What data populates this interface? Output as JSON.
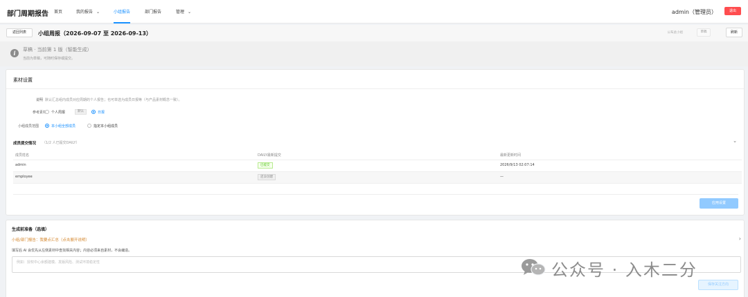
{
  "app": {
    "title": "部门周期报告"
  },
  "nav": {
    "items": [
      {
        "label": "首页",
        "has_menu": false
      },
      {
        "label": "我的报告",
        "has_menu": true
      },
      {
        "label": "小组报告",
        "has_menu": false,
        "active": true
      },
      {
        "label": "部门报告",
        "has_menu": false
      },
      {
        "label": "管理",
        "has_menu": true
      }
    ]
  },
  "user": {
    "name": "admin（管理员）",
    "logout_label": "退出"
  },
  "page": {
    "back_label": "返回列表",
    "title": "小组周报（2026-09-07 至 2026-09-13）",
    "publish_label": "公布此小组",
    "draft_label": "草稿",
    "new_label": "刷新"
  },
  "status": {
    "title": "草稿 · 当前第 1 版（智能生成）",
    "subtitle": "当前为草稿，可随时保存或提交。"
  },
  "material": {
    "title": "素材设置",
    "desc_label": "说明",
    "desc_text": "默认汇总组内成员对应周期的个人报告；也可单选为成员日报等（与产品素材概念一致）。",
    "ref_label": "参考素材",
    "ref_options": [
      "个人周报",
      "日报"
    ],
    "ref_default_tag": "默认",
    "ref_selected": "日报",
    "scope_label": "小组成员范围",
    "scope_options": [
      "本小组全部成员",
      "指定本小组成员"
    ],
    "scope_selected": "本小组全部成员",
    "apply_label": "应用设置"
  },
  "submission": {
    "title": "成员提交情况",
    "count": "（1/2 人已提交DAILY）",
    "columns": [
      "成员姓名",
      "DAILY最新提交",
      "最新更新时间"
    ],
    "rows": [
      {
        "name": "admin",
        "status": "已提交",
        "time": "2026/9/13 02:07:14"
      },
      {
        "name": "employee",
        "status": "还没创建",
        "time": "—"
      }
    ]
  },
  "prep": {
    "title": "生成前准备（选填）",
    "link": "小组/部门报告：我要点汇总（点击展开说明）",
    "hint": "填写后 AI 会优先从左侧素材中查找相关内容；内容必须来自素材，不会编造。",
    "placeholder": "例如：授权中心余额建模、发版风险、测试环境稳定性",
    "button_label": "保存关注方向"
  },
  "watermark": {
    "text": "公众号 · 入木二分"
  }
}
